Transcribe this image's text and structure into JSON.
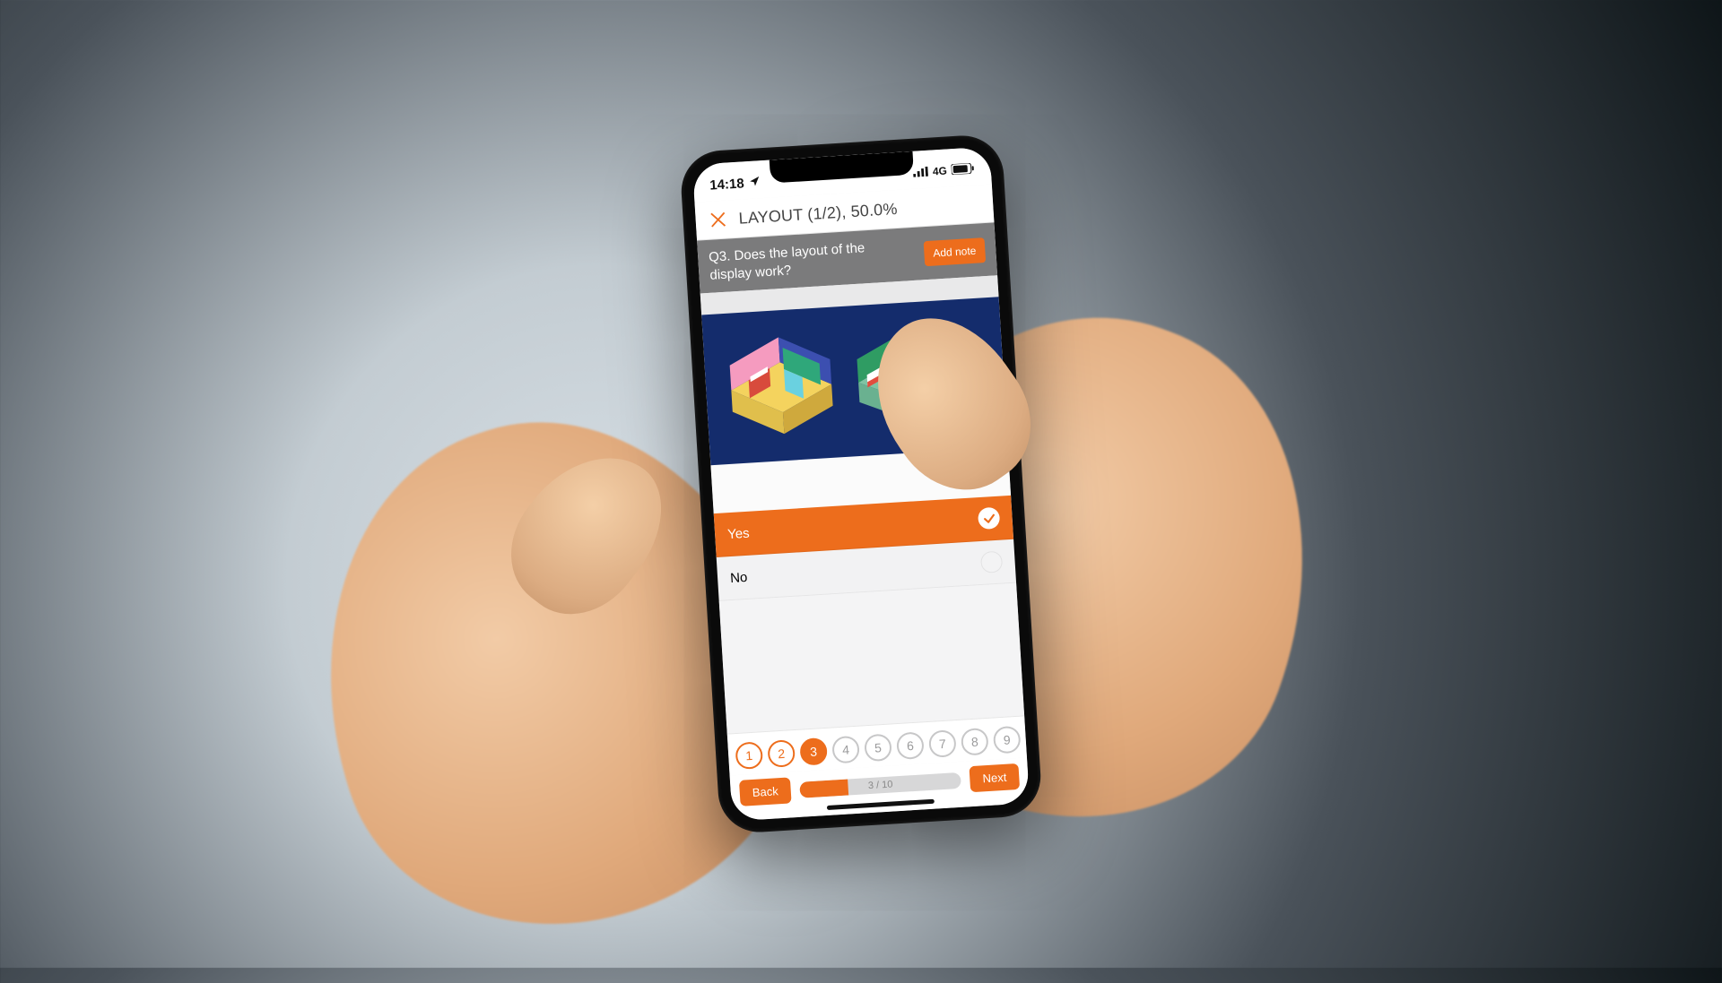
{
  "status": {
    "time": "14:18",
    "network": "4G"
  },
  "header": {
    "title": "LAYOUT (1/2), 50.0%"
  },
  "question": {
    "text": "Q3. Does the layout of the display work?",
    "add_note_label": "Add note"
  },
  "options": [
    {
      "label": "Yes",
      "selected": true
    },
    {
      "label": "No",
      "selected": false
    }
  ],
  "pager": {
    "items": [
      {
        "n": "1",
        "state": "done"
      },
      {
        "n": "2",
        "state": "done"
      },
      {
        "n": "3",
        "state": "active"
      },
      {
        "n": "4",
        "state": "todo"
      },
      {
        "n": "5",
        "state": "todo"
      },
      {
        "n": "6",
        "state": "todo"
      },
      {
        "n": "7",
        "state": "todo"
      },
      {
        "n": "8",
        "state": "todo"
      },
      {
        "n": "9",
        "state": "todo"
      }
    ]
  },
  "nav": {
    "back_label": "Back",
    "next_label": "Next",
    "progress_text": "3 / 10",
    "progress_pct": 30
  },
  "colors": {
    "accent": "#ed6d1c",
    "question_bar": "#7b7b7c",
    "illustration_bg": "#142c6c"
  }
}
